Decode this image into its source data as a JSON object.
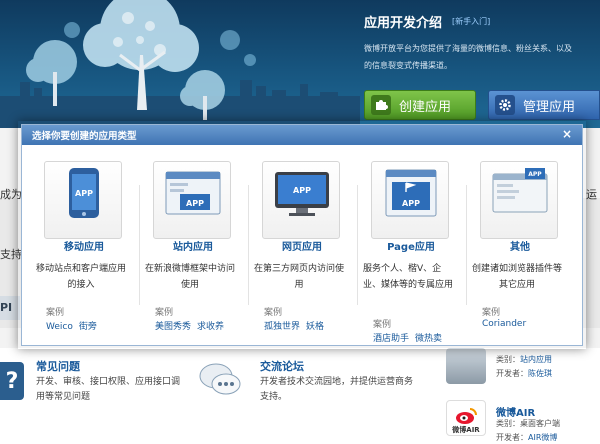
{
  "banner": {
    "title": "应用开发介绍",
    "link": "[新手入门]",
    "desc_line1": "微博开放平台为您提供了海量的微博信息、粉丝关系、以及",
    "desc_line2": "的信息裂变式传播渠道。",
    "create_label": "创建应用",
    "manage_label": "管理应用"
  },
  "background": {
    "left_frag_1": "成为",
    "left_frag_2": "支持",
    "left_frag_3": "PI",
    "right_frag": "运",
    "faq": {
      "title": "常见问题",
      "desc": "开发、审核、接口权限、应用接口调用等常见问题"
    },
    "forum": {
      "title": "交流论坛",
      "desc": "开发者技术交流园地，并提供运营商务支持。"
    },
    "apps": [
      {
        "name": "",
        "type_label": "类别：",
        "type_value": "站内应用",
        "dev_label": "开发者：",
        "dev_value": "陈佐琪"
      },
      {
        "name": "微博AIR",
        "type_label": "类别：",
        "type_value": "桌面客户端",
        "dev_label": "开发者：",
        "dev_value": "AIR微博",
        "icon_text": "微博AIR"
      }
    ]
  },
  "modal": {
    "title": "选择你要创建的应用类型",
    "close": "×",
    "case_label": "案例",
    "types": [
      {
        "label": "移动应用",
        "icon_text": "APP",
        "desc": "移动站点和客户端应用的接入",
        "cases": [
          "Weico",
          "街旁"
        ]
      },
      {
        "label": "站内应用",
        "icon_text": "APP",
        "desc": "在新浪微博框架中访问使用",
        "cases": [
          "美图秀秀",
          "求收养"
        ]
      },
      {
        "label": "网页应用",
        "icon_text": "APP",
        "desc": "在第三方网页内访问使用",
        "cases": [
          "孤独世界",
          "妖格"
        ]
      },
      {
        "label": "Page应用",
        "icon_text": "APP",
        "desc": "服务个人、楷V、企业、媒体等的专属应用",
        "cases": [
          "酒店助手",
          "微热卖"
        ]
      },
      {
        "label": "其他",
        "icon_text": "APP",
        "desc": "创建诸如浏览器插件等其它应用",
        "cases": [
          "Coriander"
        ]
      }
    ]
  },
  "colors": {
    "accent": "#1a5a9b",
    "header": "#4f83c0",
    "green": "#5da82e",
    "blue": "#3c72b8"
  }
}
